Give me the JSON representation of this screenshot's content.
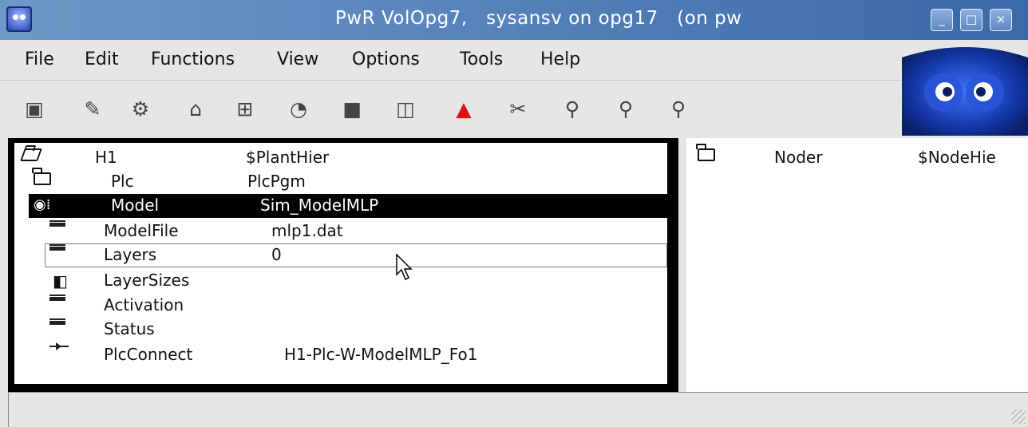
{
  "window": {
    "title": "PwR VolOpg7,   sysansv on opg17   (on pw",
    "buttons": [
      "minimize",
      "maximize",
      "close"
    ]
  },
  "menu": [
    {
      "label": "File"
    },
    {
      "label": "Edit"
    },
    {
      "label": "Functions"
    },
    {
      "label": "View"
    },
    {
      "label": "Options"
    },
    {
      "label": "Tools"
    },
    {
      "label": "Help"
    }
  ],
  "toolbar": [
    "save-icon",
    "edit-pencil-icon",
    "gears-icon",
    "hierarchy-icon",
    "network-icon",
    "runtime-icon",
    "bag-icon",
    "split-view-icon",
    "alarm-triangle-icon",
    "tools-icon",
    "zoom-in-icon",
    "zoom-reset-icon",
    "zoom-out-icon"
  ],
  "left_tree": [
    {
      "icon": "folder-open-icon",
      "col1": "H1",
      "col2": "$PlantHier",
      "selected": false
    },
    {
      "icon": "folder-icon",
      "col1": "Plc",
      "col2": "PlcPgm",
      "selected": false
    },
    {
      "icon": "eye-object-icon",
      "col1": "Model",
      "col2": "Sim_ModelMLP",
      "selected": true
    },
    {
      "icon": "attribute-icon",
      "col1": "ModelFile",
      "col2": "mlp1.dat",
      "selected": false
    },
    {
      "icon": "attribute-icon",
      "col1": "Layers",
      "col2": "0",
      "selected": false,
      "focused": true
    },
    {
      "icon": "array-icon",
      "col1": "LayerSizes",
      "col2": "",
      "selected": false
    },
    {
      "icon": "attribute-icon",
      "col1": "Activation",
      "col2": "",
      "selected": false
    },
    {
      "icon": "attribute-icon",
      "col1": "Status",
      "col2": "",
      "selected": false
    },
    {
      "icon": "connect-arrow-icon",
      "col1": "PlcConnect",
      "col2": "H1-Plc-W-ModelMLP_Fo1",
      "selected": false
    }
  ],
  "right_tree": [
    {
      "icon": "folder-icon",
      "col1": "Noder",
      "col2": "$NodeHie"
    }
  ],
  "statusbar": {
    "text": ""
  }
}
